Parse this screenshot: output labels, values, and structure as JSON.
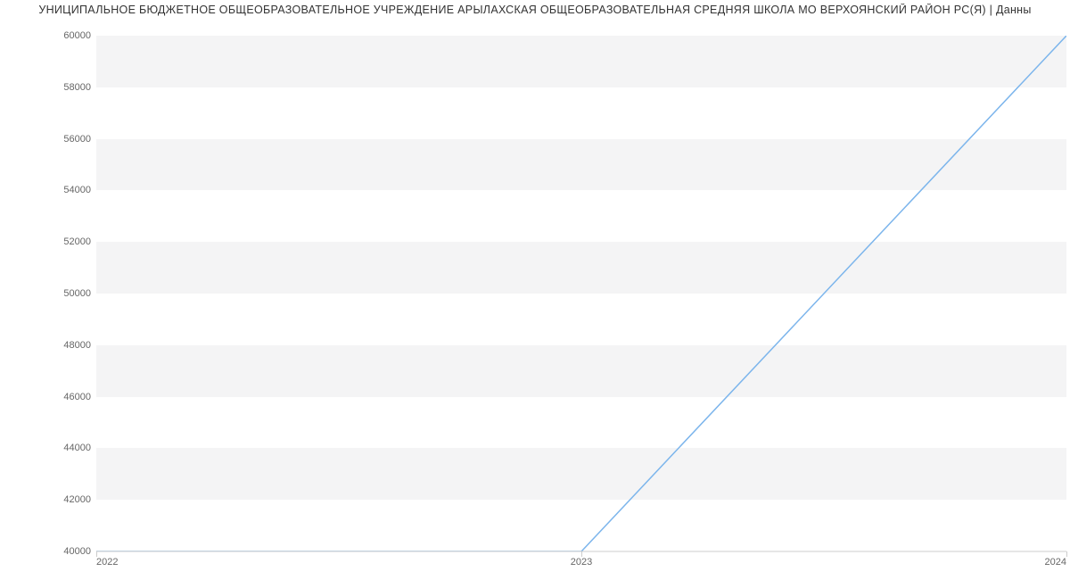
{
  "title": "УНИЦИПАЛЬНОЕ БЮДЖЕТНОЕ ОБЩЕОБРАЗОВАТЕЛЬНОЕ УЧРЕЖДЕНИЕ АРЫЛАХСКАЯ ОБЩЕОБРАЗОВАТЕЛЬНАЯ СРЕДНЯЯ ШКОЛА МО ВЕРХОЯНСКИЙ РАЙОН РС(Я) | Данны",
  "chart_data": {
    "type": "line",
    "x": [
      2022,
      2023,
      2024
    ],
    "values": [
      40000,
      40000,
      60000
    ],
    "xlabel": "",
    "ylabel": "",
    "title": "УНИЦИПАЛЬНОЕ БЮДЖЕТНОЕ ОБЩЕОБРАЗОВАТЕЛЬНОЕ УЧРЕЖДЕНИЕ АРЫЛАХСКАЯ ОБЩЕОБРАЗОВАТЕЛЬНАЯ СРЕДНЯЯ ШКОЛА МО ВЕРХОЯНСКИЙ РАЙОН РС(Я) | Данны",
    "xlim": [
      2022,
      2024
    ],
    "ylim": [
      40000,
      60000
    ],
    "y_ticks": [
      40000,
      42000,
      44000,
      46000,
      48000,
      50000,
      52000,
      54000,
      56000,
      58000,
      60000
    ],
    "x_ticks": [
      2022,
      2023,
      2024
    ],
    "line_color": "#7cb5ec"
  },
  "y_labels": {
    "t0": "40000",
    "t1": "42000",
    "t2": "44000",
    "t3": "46000",
    "t4": "48000",
    "t5": "50000",
    "t6": "52000",
    "t7": "54000",
    "t8": "56000",
    "t9": "58000",
    "t10": "60000"
  },
  "x_labels": {
    "x0": "2022",
    "x1": "2023",
    "x2": "2024"
  }
}
